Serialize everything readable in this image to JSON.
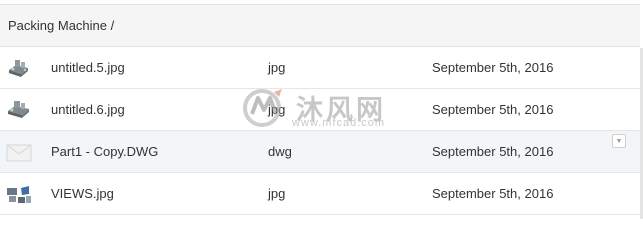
{
  "breadcrumb": {
    "path": "Packing Machine /"
  },
  "files": [
    {
      "name": "untitled.5.jpg",
      "type": "jpg",
      "date": "September 5th, 2016",
      "thumb_icon": "machine-thumbnail-icon"
    },
    {
      "name": "untitled.6.jpg",
      "type": "jpg",
      "date": "September 5th, 2016",
      "thumb_icon": "machine-thumbnail-icon"
    },
    {
      "name": "Part1 - Copy.DWG",
      "type": "dwg",
      "date": "September 5th, 2016",
      "thumb_icon": "envelope-file-icon",
      "highlighted": true
    },
    {
      "name": "VIEWS.jpg",
      "type": "jpg",
      "date": "September 5th, 2016",
      "thumb_icon": "views-thumbnail-icon"
    }
  ],
  "row_menu_glyph": "▼",
  "watermark": {
    "text": "沐风网",
    "url": "www.mfcad.com"
  },
  "colors": {
    "header_bg": "#f5f5f5",
    "highlight_row": "#f3f6f9",
    "divider": "#e6e6e6",
    "text": "#333333"
  }
}
